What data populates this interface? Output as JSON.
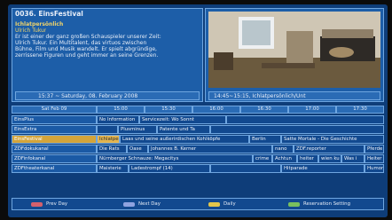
{
  "header": {
    "channel_title": "0036. EinsFestival"
  },
  "info": {
    "program_title": "Ichlatpersönlich",
    "subtitle": "Ulrich Tukur",
    "description_lines": [
      "Er ist einer der ganz großen Schauspieler unserer Zeit:",
      "Ulrich Tukur. Ein Multitalent, das virtuos zwischen",
      "Bühne, Film und Musik wandelt. Er spielt abgründige,",
      "zerrissene Figuren und geht immer an seine Grenzen."
    ],
    "time_range": "15:37 ~ Saturday, 08. February 2008",
    "preview_caption": "14:45~15:15, Ichlatpersönlich/Unt"
  },
  "grid": {
    "date_label": "Sat Feb 09",
    "time_slots": [
      "15:00",
      "15:30",
      "16:00",
      "16:30",
      "17:00",
      "17:30"
    ],
    "rows": [
      {
        "channel": "EinsPlus",
        "programs": [
          "No Information",
          "Servicezeit: Wo Sonnt"
        ]
      },
      {
        "channel": "EinsExtra",
        "programs": [
          "Plusminus",
          "Patente und Ta"
        ]
      },
      {
        "channel": "EinsFestival",
        "programs": [
          "Ichlatper",
          "Laas und seine außerirdischen Kohlköpfe",
          "Berlin",
          "Satte Mortale - Die Geschichte"
        ]
      },
      {
        "channel": "ZDFdokukanal",
        "programs": [
          "Die Rats",
          "Oase",
          "Johannes B. Kerner",
          "nano",
          "ZDF.reporter",
          "Pferde"
        ]
      },
      {
        "channel": "ZDFinfokanal",
        "programs": [
          "Nürnberger Schnauze: Megacitys",
          "crime",
          "Achtun",
          "heiter",
          "wien ku",
          "Was i",
          "Heiter"
        ]
      },
      {
        "channel": "ZDFtheaterkanal",
        "programs": [
          "Maisterie",
          "Ladestrompf (14)",
          "Hitparade",
          "Humor"
        ]
      }
    ]
  },
  "legend": {
    "items": [
      {
        "label": "Prev Day",
        "color": "#d4606c"
      },
      {
        "label": "Next Day",
        "color": "#8fa3e0"
      },
      {
        "label": "Daily",
        "color": "#e2c64b"
      },
      {
        "label": "Reservation Setting",
        "color": "#79c05e"
      }
    ]
  },
  "colors": {
    "background": "#0e3d79",
    "panel": "#1d5ea8",
    "border": "#6fa6e0",
    "highlight": "#d3a43a"
  }
}
